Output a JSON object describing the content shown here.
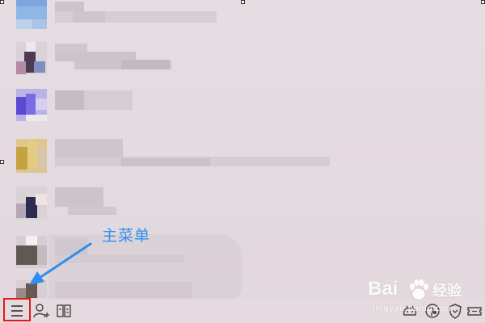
{
  "annotation": {
    "label": "主菜单"
  },
  "toolbar": {
    "buttons": [
      {
        "name": "main-menu-button",
        "icon": "menu-icon"
      },
      {
        "name": "add-contact-button",
        "icon": "add-user-icon"
      },
      {
        "name": "app-manager-button",
        "icon": "apps-icon"
      },
      {
        "name": "pet-button",
        "icon": "pet-icon"
      },
      {
        "name": "weather-button",
        "icon": "globe-icon"
      },
      {
        "name": "security-button",
        "icon": "shield-icon"
      },
      {
        "name": "ticket-button",
        "icon": "ticket-icon"
      }
    ]
  },
  "watermark": {
    "brand_left": "Bai",
    "brand_right": "经验",
    "url": "jingyan.baidu.com"
  },
  "colors": {
    "highlight_border": "#e21b1b",
    "annotation_blue": "#2f8ff0",
    "background": "#e3d9df"
  }
}
